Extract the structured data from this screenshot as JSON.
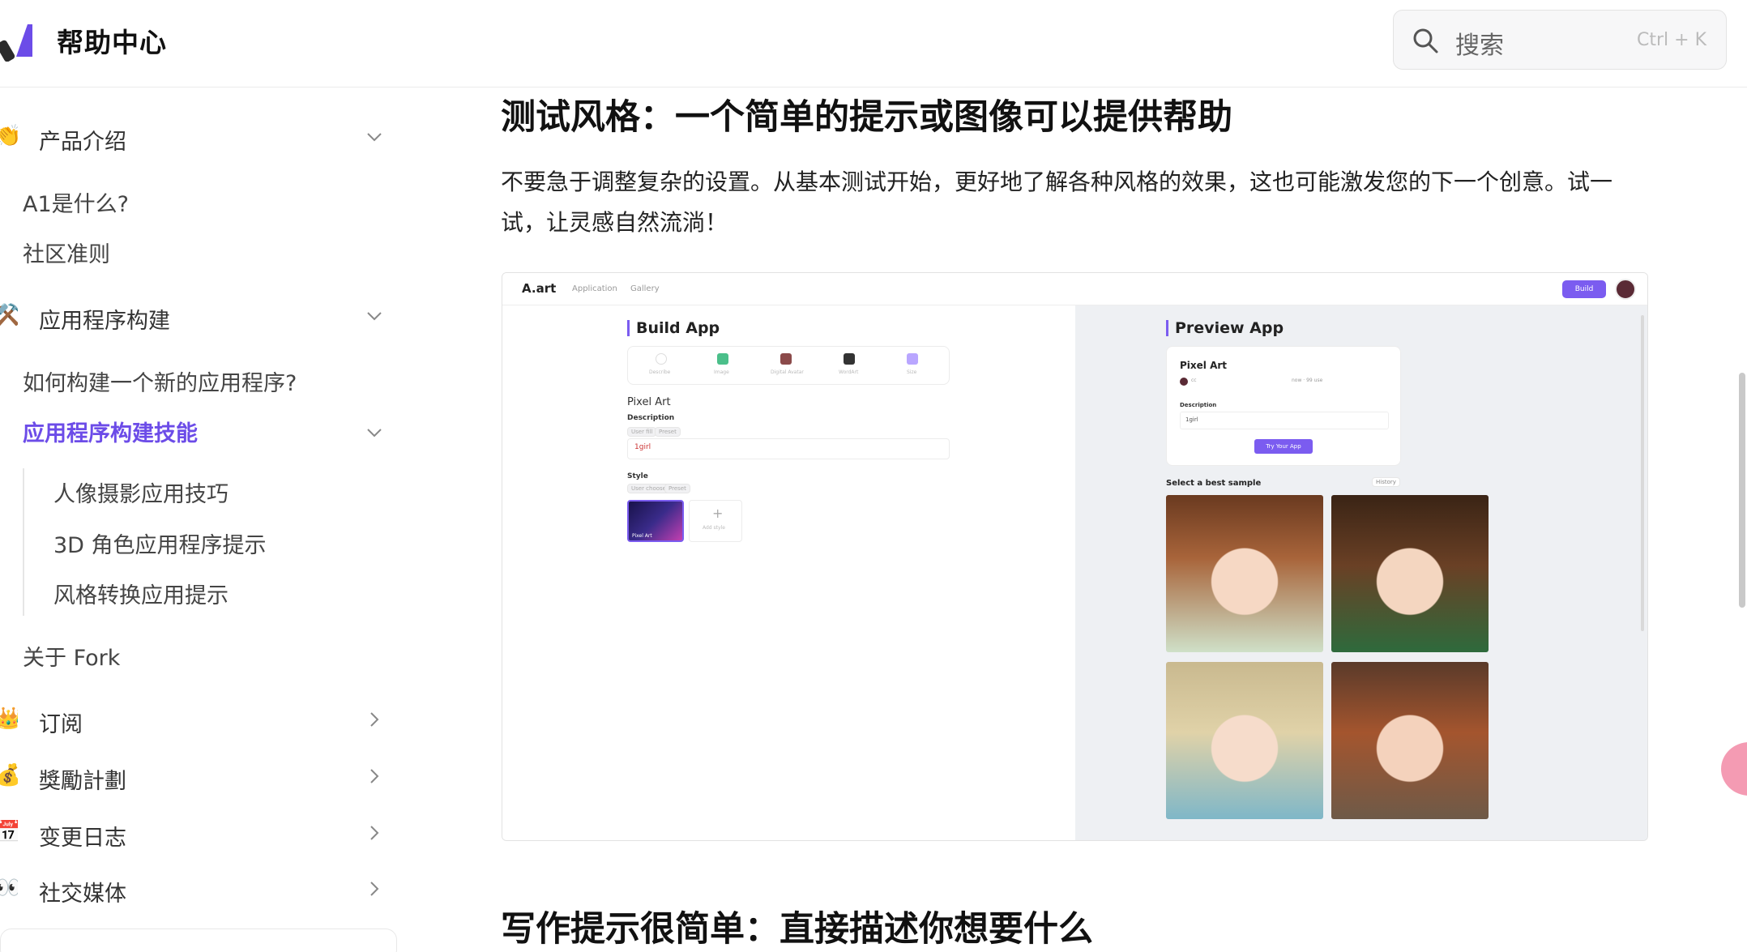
{
  "header": {
    "brand": "帮助中心",
    "search": {
      "placeholder": "搜索",
      "shortcut": "Ctrl + K"
    }
  },
  "sidebar": {
    "sections": [
      {
        "emoji": "👏",
        "label": "产品介绍"
      },
      {
        "emoji": "⚒️",
        "label": "应用程序构建"
      },
      {
        "emoji": "👑",
        "label": "订阅"
      },
      {
        "emoji": "💰",
        "label": "獎勵計劃"
      },
      {
        "emoji": "📅",
        "label": "变更日志"
      },
      {
        "emoji": "👀",
        "label": "社交媒体"
      }
    ],
    "intro_items": [
      "A1是什么?",
      "社区准则"
    ],
    "build_items": [
      "如何构建一个新的应用程序?",
      "应用程序构建技能"
    ],
    "skill_items": [
      "人像摄影应用技巧",
      "3D 角色应用程序提示",
      "风格转换应用提示"
    ],
    "fork_item": "关于 Fork"
  },
  "main": {
    "heading1": "测试风格：一个简单的提示或图像可以提供帮助",
    "paragraph": "不要急于调整复杂的设置。从基本测试开始，更好地了解各种风格的效果，这也可能激发您的下一个创意。试一试，让灵感自然流淌！",
    "heading2": "写作提示很简单：直接描述你想要什么"
  },
  "screenshot": {
    "logo": "A.art",
    "nav": [
      "Application",
      "Gallery"
    ],
    "build_btn": "Build",
    "build_title": "Build App",
    "preview_title": "Preview App",
    "modes": [
      "Describe",
      "Image",
      "Digital Avatar",
      "WordArt",
      "Size"
    ],
    "app_name": "Pixel Art",
    "description_label": "Description",
    "desc_tags": [
      "User fill",
      "Preset"
    ],
    "desc_value": "1girl",
    "style_label": "Style",
    "style_tags": [
      "User choose",
      "Preset"
    ],
    "style_thumb_label": "Pixel Art",
    "add_style": "Add style",
    "preview_name": "Pixel Art",
    "preview_user": "cc",
    "preview_meta": "now · 99 use",
    "preview_desc_label": "Description",
    "preview_desc_value": "1girl",
    "try_btn": "Try Your App",
    "select_sample": "Select a best sample",
    "history": "History"
  },
  "colors": {
    "accent": "#6c4ce8",
    "button": "#7b5cf0"
  }
}
